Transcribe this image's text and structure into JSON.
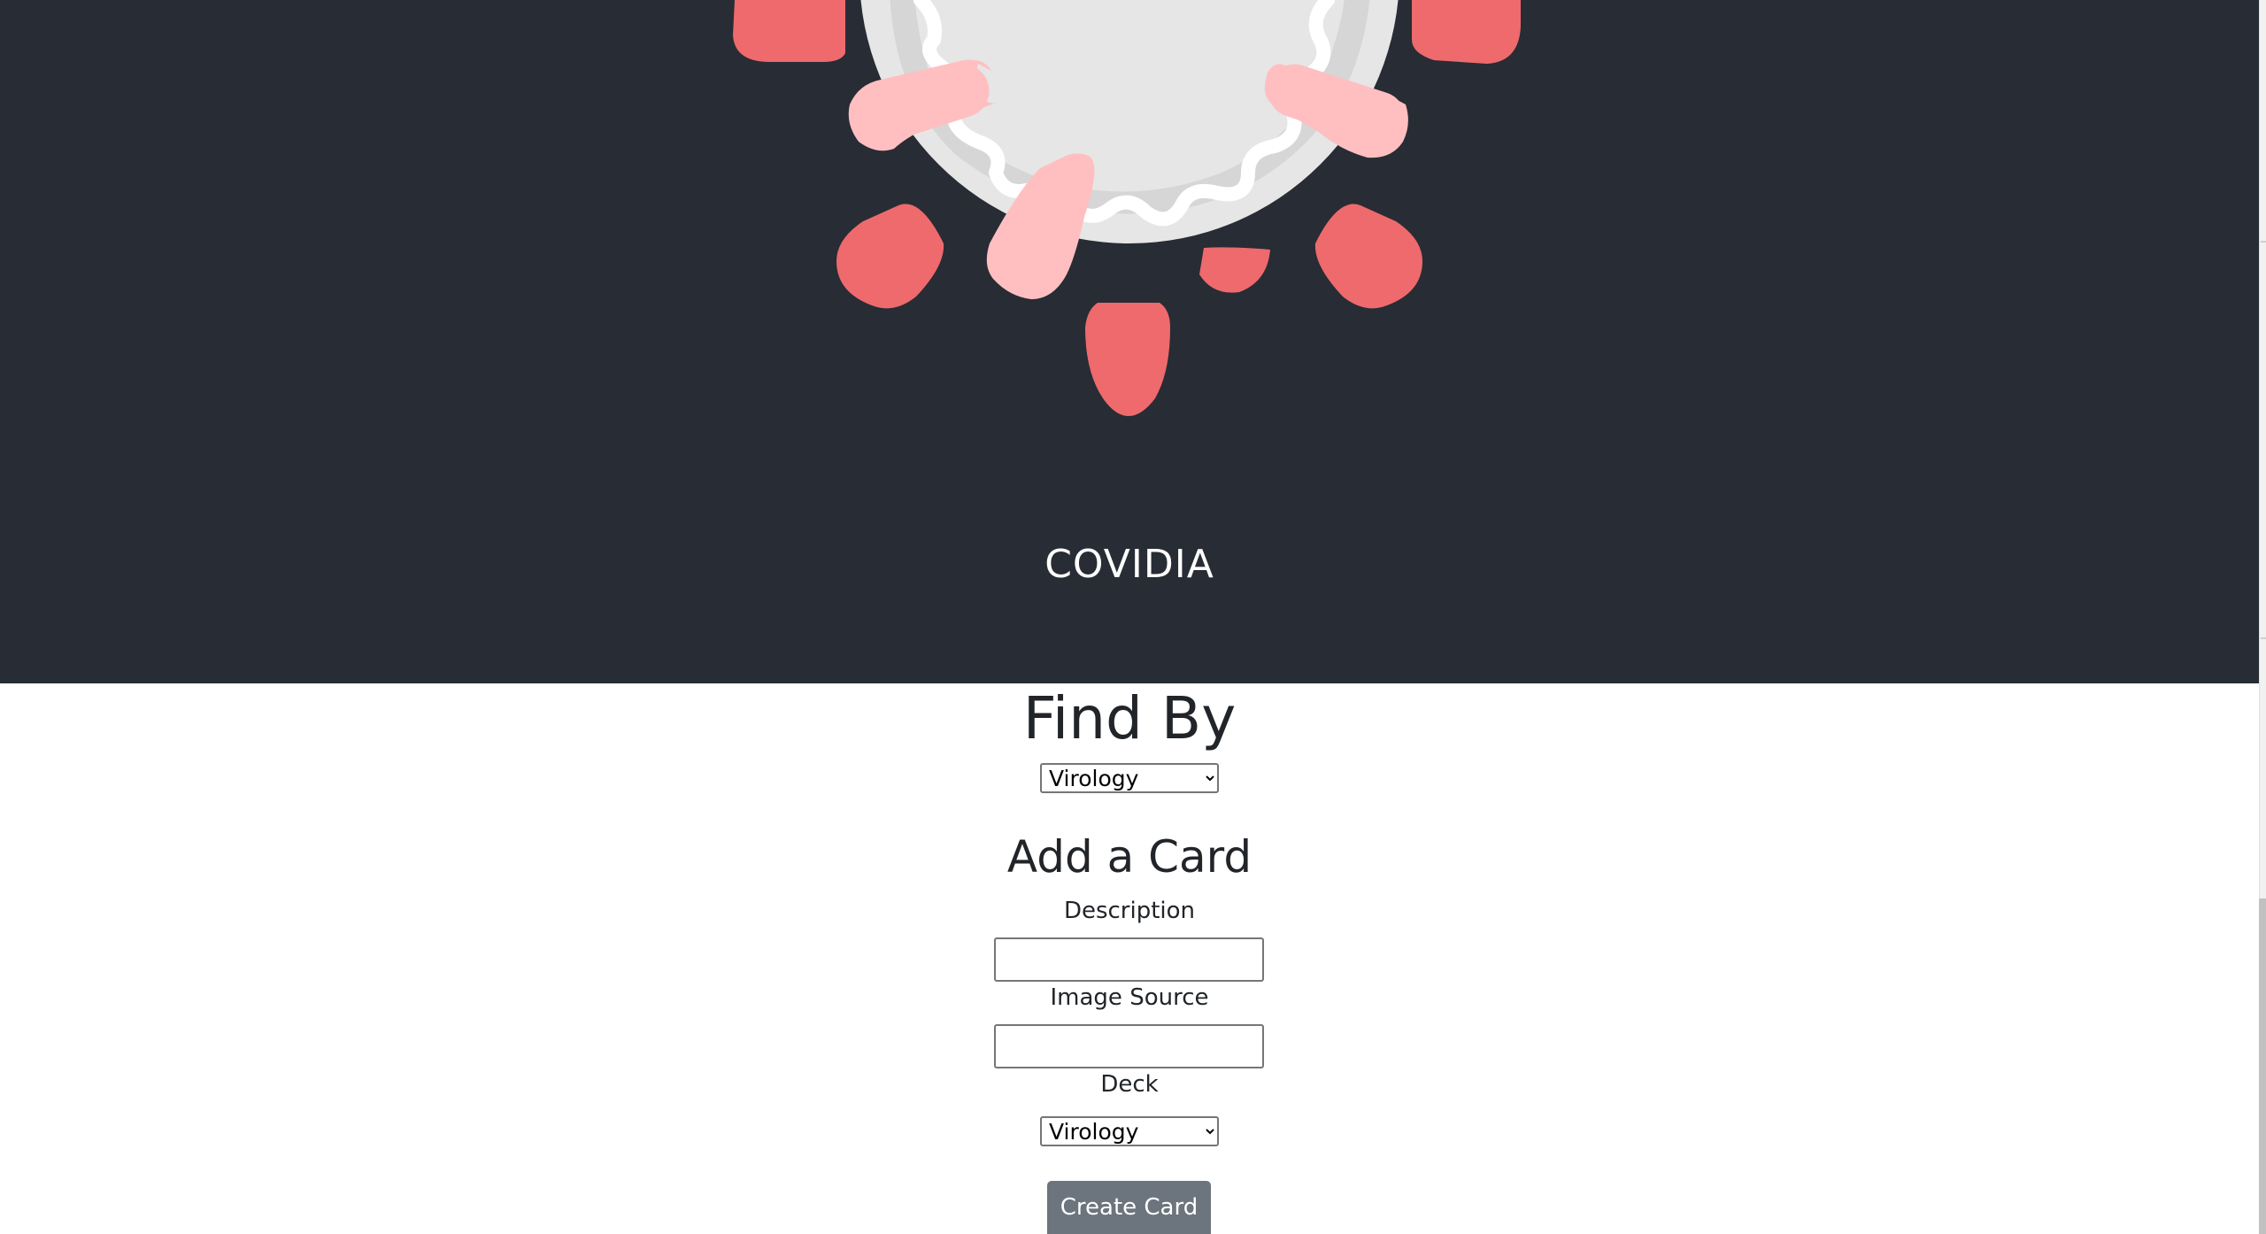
{
  "header": {
    "app_title": "COVIDIA",
    "logo_icon": "virus-icon"
  },
  "find_by": {
    "heading": "Find By",
    "selected_deck": "Virology",
    "options": [
      "Virology"
    ]
  },
  "add_card": {
    "heading": "Add a Card",
    "description_label": "Description",
    "description_value": "",
    "image_source_label": "Image Source",
    "image_source_value": "",
    "deck_label": "Deck",
    "deck_selected": "Virology",
    "deck_options": [
      "Virology"
    ],
    "submit_label": "Create Card"
  },
  "colors": {
    "header_bg": "#282c34",
    "virus_body": "#e6e6e6",
    "virus_ring": "#d6d6d6",
    "spike_red": "#ee6a6d",
    "spike_pink": "#ffbfc1",
    "button_bg": "#6c757d",
    "text": "#212529"
  }
}
